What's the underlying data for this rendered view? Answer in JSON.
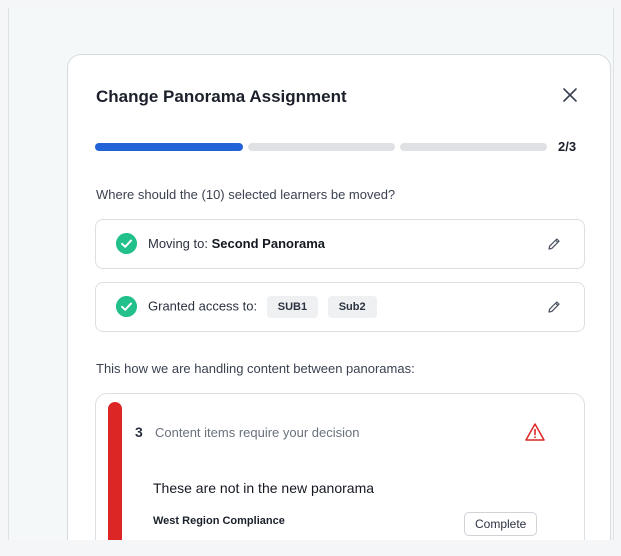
{
  "modal": {
    "title": "Change Panorama Assignment",
    "step": "2/3",
    "progress": {
      "current": 2,
      "total": 3
    },
    "question": "Where should the (10) selected learners be moved?",
    "moving": {
      "label": "Moving to:",
      "value": "Second Panorama"
    },
    "access": {
      "label": "Granted access to:",
      "chips": [
        "SUB1",
        "Sub2"
      ]
    },
    "handling_text": "This how we are handling content between panoramas:",
    "decision": {
      "count": "3",
      "text": "Content items require your decision",
      "subheading": "These are not in the new panorama",
      "item_name": "West Region Compliance",
      "item_action": "Complete"
    }
  },
  "colors": {
    "accent": "#2162d9",
    "success": "#22c08a",
    "danger": "#dc2626",
    "border": "#dcdfe4"
  },
  "icons": {
    "close": "close-icon",
    "check": "check-circle-icon",
    "edit": "pencil-icon",
    "warning": "warning-triangle-icon"
  }
}
